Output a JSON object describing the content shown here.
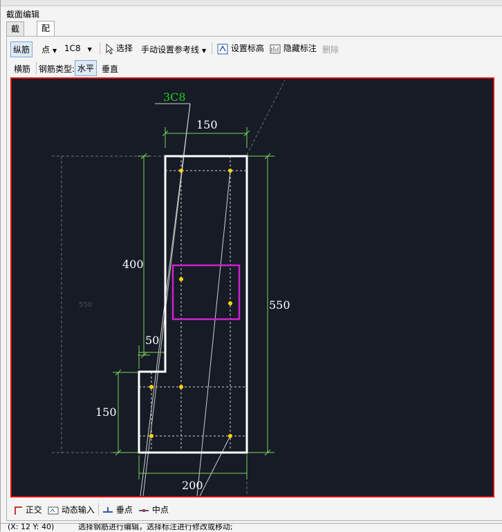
{
  "window": {
    "title": "截面编辑"
  },
  "tabs": [
    {
      "label": "截面"
    },
    {
      "label": "配筋"
    }
  ],
  "toolbar1": {
    "longitudinal": "纵筋",
    "mode": "点",
    "rebar_spec": "1C8",
    "select": "选择",
    "ref_line": "手动设置参考线",
    "set_elevation": "设置标高",
    "hide_annotation": "隐藏标注",
    "delete": "删除"
  },
  "toolbar2": {
    "transverse": "横筋",
    "type_label": "钢筋类型:",
    "horizontal": "水平",
    "vertical": "垂直"
  },
  "drawing": {
    "rebar_label": "3C8",
    "dim_top": "150",
    "dim_left": "400",
    "dim_right": "550",
    "dim_step": "50",
    "dim_lower_left": "150",
    "dim_bottom": "200",
    "faint_dim": "550",
    "colors": {
      "outline": "#ffffff",
      "dim": "#7cd55a",
      "rebar": "#ffd400",
      "selection": "#d020d0",
      "label": "#1ed01e"
    }
  },
  "bottom_tools": {
    "ortho": "正交",
    "dynamic_input": "动态输入",
    "perpendicular": "垂点",
    "midpoint": "中点"
  },
  "status": {
    "coords": "(X: 12 Y: 40)",
    "hint": "选择钢筋进行编辑，选择标注进行修改或移动;"
  }
}
